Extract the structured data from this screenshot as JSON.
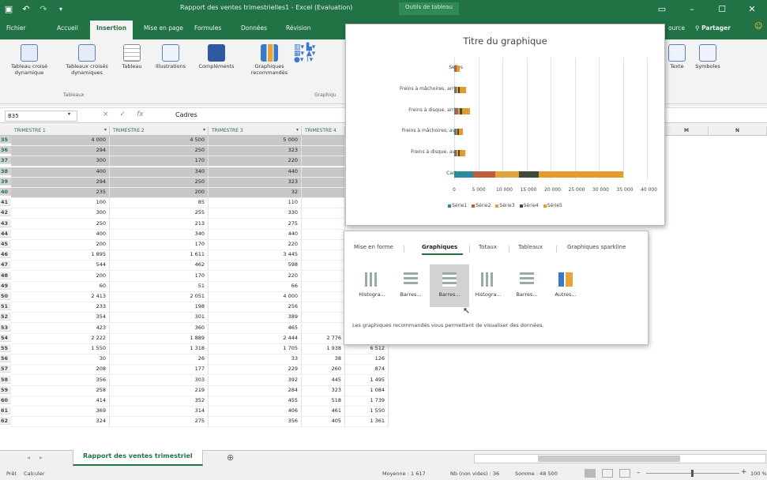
{
  "app": {
    "title": "Rapport des ventes trimestrielles1 - Excel (Evaluation)",
    "context_title": "Outils de tableau"
  },
  "titlebar_icons": [
    "excel-icon",
    "undo-icon",
    "redo-icon",
    "customize-icon"
  ],
  "window_controls": [
    "ribbon-display-icon",
    "minimize-icon",
    "maximize-icon",
    "close-icon"
  ],
  "menu": {
    "tabs": [
      "Fichier",
      "Accueil",
      "Insertion",
      "Mise en page",
      "Formules",
      "Données",
      "Révision"
    ],
    "active": "Insertion",
    "right_text": "ource",
    "share": "Partager"
  },
  "ribbon": {
    "tableau_croise": "Tableau croisé dynamique",
    "tableaux_recommandes": "Tableaux croisés dynamiques",
    "tableau": "Tableau",
    "illustrations": "Illustrations",
    "complements": "Compléments",
    "graphiques_rec": "Graphiques recommandés",
    "texte": "Texte",
    "symboles": "Symboles",
    "group_tableaux": "Tableaux",
    "group_graphiques": "Graphiqu"
  },
  "formula": {
    "namebox": "B35",
    "value": "Cadres",
    "cancel": "×",
    "enter": "✓",
    "fx": "fx"
  },
  "columns": [
    "TRIMESTRE 1",
    "TRIMESTRE 2",
    "TRIMESTRE 3",
    "TRIMESTRE 4"
  ],
  "right_columns": [
    "M",
    "N"
  ],
  "rows": [
    {
      "n": "35",
      "v": [
        "4 000",
        "4 500",
        "5 000",
        ""
      ],
      "sel": true
    },
    {
      "n": "36",
      "v": [
        "294",
        "250",
        "323",
        ""
      ],
      "sel": true
    },
    {
      "n": "37",
      "v": [
        "300",
        "170",
        "220",
        ""
      ],
      "sel": true
    },
    {
      "n": "38",
      "v": [
        "400",
        "340",
        "440",
        ""
      ],
      "sel": true
    },
    {
      "n": "39",
      "v": [
        "294",
        "250",
        "323",
        ""
      ],
      "sel": true
    },
    {
      "n": "40",
      "v": [
        "235",
        "200",
        "32",
        ""
      ],
      "sel": true
    },
    {
      "n": "41",
      "v": [
        "100",
        "85",
        "110",
        ""
      ]
    },
    {
      "n": "42",
      "v": [
        "300",
        "255",
        "330",
        ""
      ]
    },
    {
      "n": "43",
      "v": [
        "250",
        "213",
        "275",
        ""
      ]
    },
    {
      "n": "44",
      "v": [
        "400",
        "340",
        "440",
        ""
      ]
    },
    {
      "n": "45",
      "v": [
        "200",
        "170",
        "220",
        ""
      ]
    },
    {
      "n": "46",
      "v": [
        "1 895",
        "1 611",
        "3 445",
        ""
      ]
    },
    {
      "n": "47",
      "v": [
        "544",
        "462",
        "598",
        ""
      ]
    },
    {
      "n": "48",
      "v": [
        "200",
        "170",
        "220",
        ""
      ]
    },
    {
      "n": "49",
      "v": [
        "60",
        "51",
        "66",
        ""
      ]
    },
    {
      "n": "50",
      "v": [
        "2 413",
        "2 051",
        "4 000",
        ""
      ]
    },
    {
      "n": "51",
      "v": [
        "233",
        "198",
        "256",
        ""
      ]
    },
    {
      "n": "52",
      "v": [
        "354",
        "301",
        "389",
        ""
      ]
    },
    {
      "n": "53",
      "v": [
        "423",
        "360",
        "465",
        ""
      ]
    },
    {
      "n": "54",
      "v": [
        "2 222",
        "1 889",
        "2 444",
        "2 776",
        "9 332"
      ]
    },
    {
      "n": "55",
      "v": [
        "1 550",
        "1 318",
        "1 705",
        "1 938",
        "6 512"
      ]
    },
    {
      "n": "56",
      "v": [
        "30",
        "26",
        "33",
        "38",
        "126"
      ]
    },
    {
      "n": "57",
      "v": [
        "208",
        "177",
        "229",
        "260",
        "874"
      ]
    },
    {
      "n": "58",
      "v": [
        "356",
        "303",
        "392",
        "445",
        "1 495"
      ]
    },
    {
      "n": "59",
      "v": [
        "258",
        "219",
        "284",
        "323",
        "1 084"
      ]
    },
    {
      "n": "60",
      "v": [
        "414",
        "352",
        "455",
        "518",
        "1 739"
      ]
    },
    {
      "n": "61",
      "v": [
        "369",
        "314",
        "406",
        "461",
        "1 550"
      ]
    },
    {
      "n": "62",
      "v": [
        "324",
        "275",
        "356",
        "405",
        "1 361"
      ]
    }
  ],
  "sheet": {
    "tab": "Rapport des ventes trimestriel",
    "add": "⊕"
  },
  "status": {
    "ready": "Prêt",
    "calc": "Calculer",
    "average": "Moyenne : 1 617",
    "count": "Nb (non vides) : 36",
    "sum": "Somme : 48 500",
    "zoom": "100 %"
  },
  "chart_data": {
    "type": "bar",
    "orientation": "horizontal",
    "stacked": true,
    "title": "Titre du graphique",
    "categories": [
      "Cadres",
      "Freins à disque, avant",
      "Freins à mâchoires, avant",
      "Freins à disque, arrière",
      "Freins à mâchoires, arrière",
      "Selles"
    ],
    "series": [
      {
        "name": "Série1",
        "color": "#2b8a9e",
        "values": [
          4000,
          294,
          300,
          400,
          294,
          235
        ]
      },
      {
        "name": "Série2",
        "color": "#c05c3c",
        "values": [
          4500,
          250,
          170,
          340,
          250,
          200
        ]
      },
      {
        "name": "Série3",
        "color": "#e0a23a",
        "values": [
          5000,
          323,
          220,
          440,
          323,
          32
        ]
      },
      {
        "name": "Série4",
        "color": "#3f4a38",
        "values": [
          4000,
          294,
          220,
          440,
          323,
          100
        ]
      },
      {
        "name": "Série5",
        "color": "#e59a2e",
        "values": [
          17500,
          1161,
          910,
          1620,
          1190,
          567
        ]
      }
    ],
    "xlim": [
      0,
      40000
    ],
    "x_ticks": [
      "0",
      "5 000",
      "10 000",
      "15 000",
      "20 000",
      "25 000",
      "30 000",
      "35 000",
      "40 000"
    ],
    "grid": true,
    "legend": "bottom"
  },
  "quick_analysis": {
    "tabs": [
      "Mise en forme",
      "Graphiques",
      "Totaux",
      "Tableaux",
      "Graphiques sparkline"
    ],
    "active": "Graphiques",
    "options": [
      {
        "label": "Histogra...",
        "icon": "clustered-column-icon"
      },
      {
        "label": "Barres...",
        "icon": "clustered-bar-icon"
      },
      {
        "label": "Barres...",
        "icon": "stacked-bar-icon"
      },
      {
        "label": "Histogra...",
        "icon": "stacked-column-icon"
      },
      {
        "label": "Barres...",
        "icon": "bar-100-icon"
      },
      {
        "label": "Autres...",
        "icon": "more-charts-icon"
      }
    ],
    "selected": 2,
    "description": "Les graphiques recommandés vous permettent de visualiser des données."
  },
  "colors": {
    "excel_green": "#217346",
    "selection": "#c8c8c8"
  }
}
